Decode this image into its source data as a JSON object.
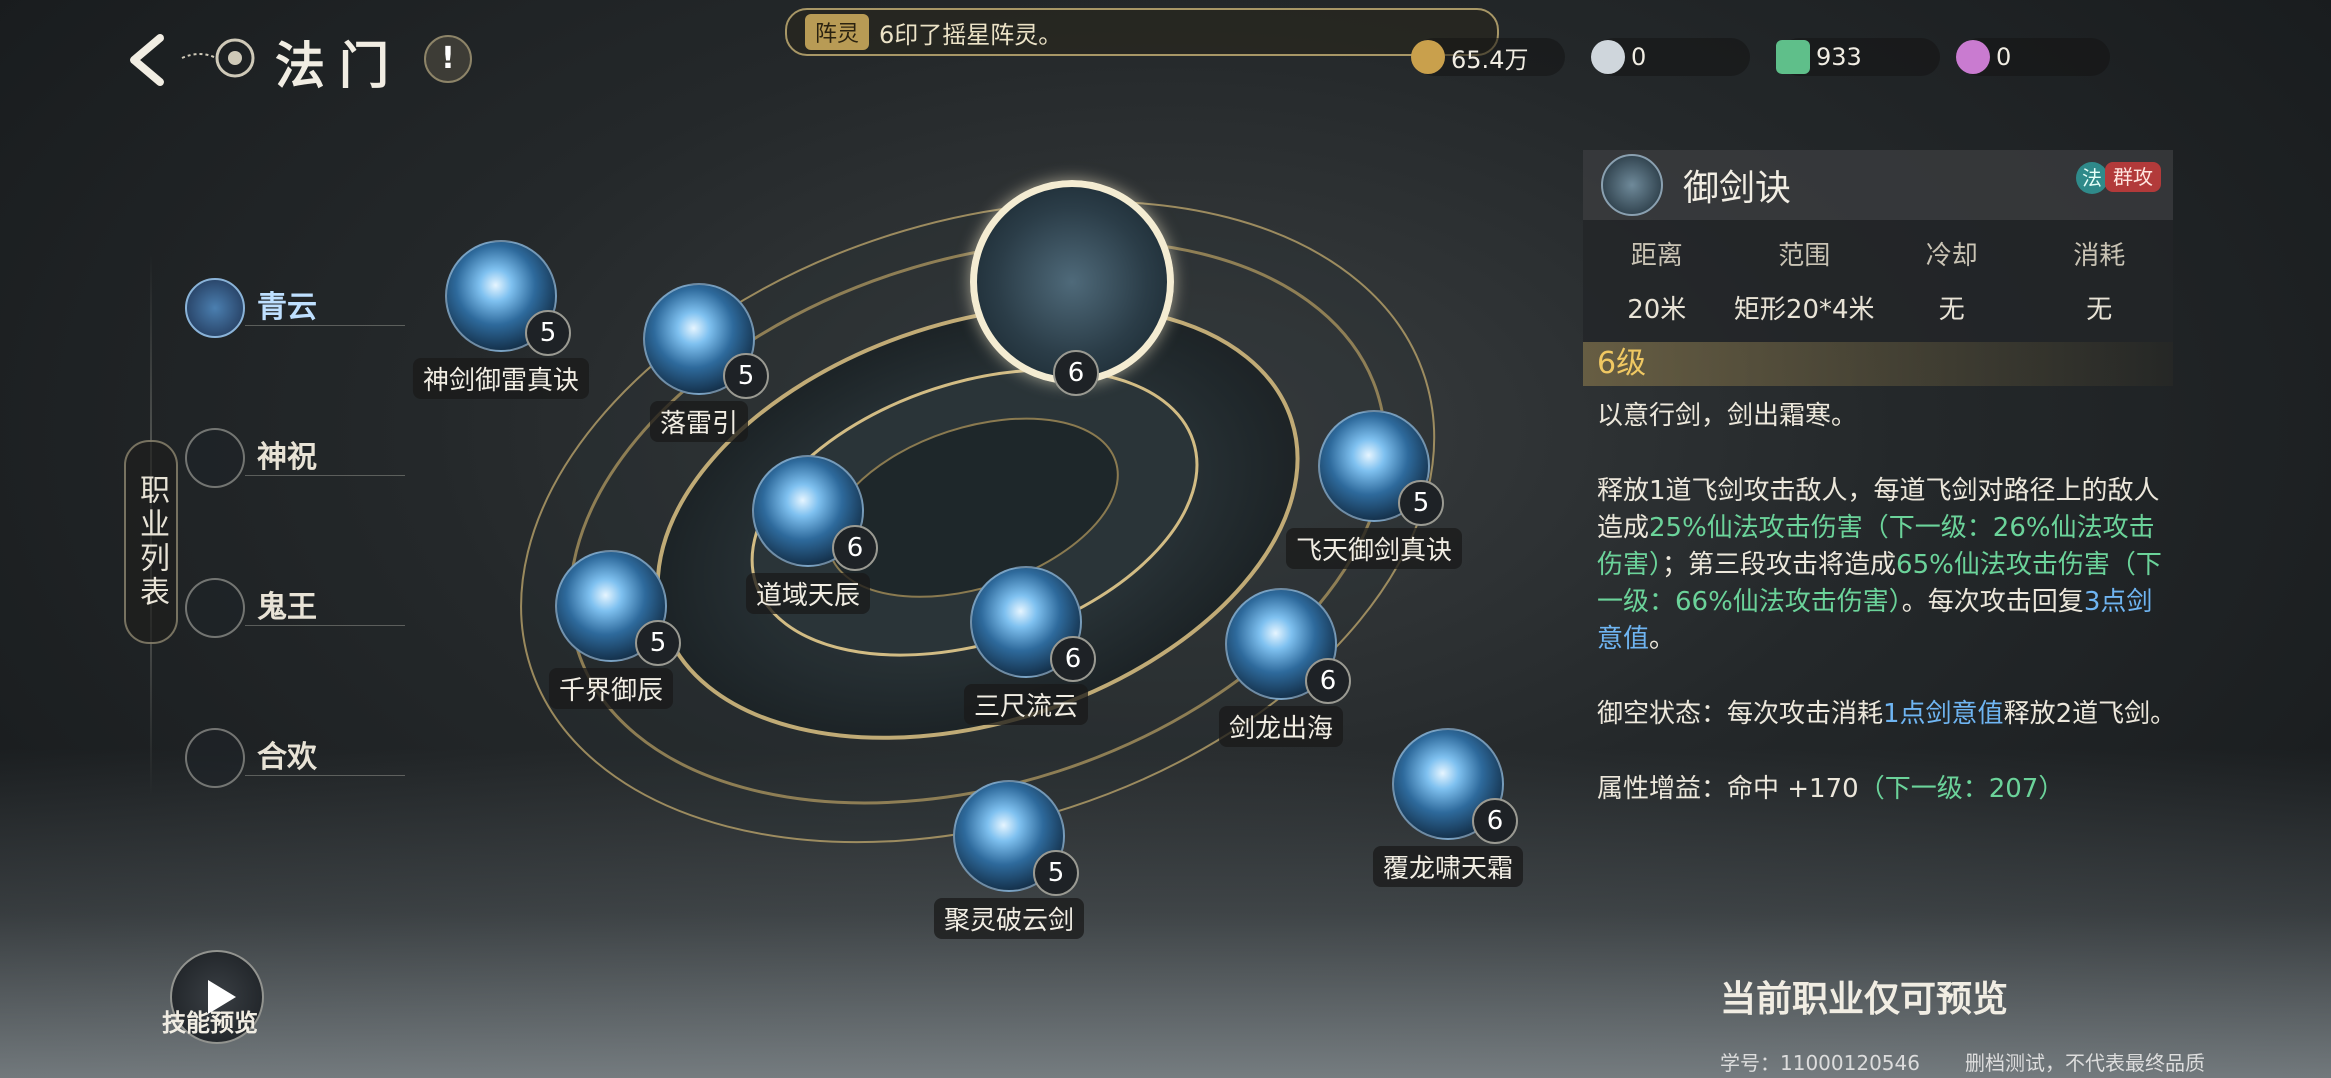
{
  "header": {
    "title": "法门",
    "info_icon": "!",
    "notice": {
      "tag": "阵灵",
      "text": "6印了摇星阵灵。"
    },
    "resources": [
      {
        "name": "coin-icon",
        "value": "65.4万",
        "color": "#c9a04c"
      },
      {
        "name": "ingot-icon",
        "value": "0",
        "color": "#cfd6dc"
      },
      {
        "name": "jade-icon",
        "value": "933",
        "color": "#5fbf8a"
      },
      {
        "name": "pearl-icon",
        "value": "0",
        "color": "#c97bd0"
      }
    ]
  },
  "sidebar": {
    "section_label": "职业列表",
    "items": [
      {
        "label": "青云",
        "active": true
      },
      {
        "label": "神祝",
        "active": false
      },
      {
        "label": "鬼王",
        "active": false
      },
      {
        "label": "合欢",
        "active": false
      }
    ]
  },
  "skills": [
    {
      "name": "神剑御雷真诀",
      "level": "5"
    },
    {
      "name": "落雷引",
      "level": "5"
    },
    {
      "name": "",
      "level": "6",
      "selected": true
    },
    {
      "name": "道域天辰",
      "level": "6"
    },
    {
      "name": "飞天御剑真诀",
      "level": "5"
    },
    {
      "name": "千界御辰",
      "level": "5"
    },
    {
      "name": "三尺流云",
      "level": "6"
    },
    {
      "name": "剑龙出海",
      "level": "6"
    },
    {
      "name": "覆龙啸天霜",
      "level": "6"
    },
    {
      "name": "聚灵破云剑",
      "level": "5"
    }
  ],
  "detail": {
    "name": "御剑诀",
    "tag_type": "法",
    "tag_attack": "群攻",
    "stats_headers": [
      "距离",
      "范围",
      "冷却",
      "消耗"
    ],
    "stats_values": [
      "20米",
      "矩形20*4米",
      "无",
      "无"
    ],
    "level": "6级",
    "flavor": "以意行剑，剑出霜寒。",
    "desc1_a": "释放1道飞剑攻击敌人，每道飞剑对路径上的敌人造成",
    "desc1_b": "25%仙法攻击伤害（下一级：26%仙法攻击伤害）",
    "desc1_c": "；第三段攻击将造成",
    "desc1_d": "65%仙法攻击伤害（下一级：66%仙法攻击伤害）",
    "desc1_e": "。每次攻击回复",
    "desc1_f": "3点剑意值",
    "desc1_g": "。",
    "desc2_a": "御空状态：每次攻击消耗",
    "desc2_b": "1点剑意值",
    "desc2_c": "释放2道飞剑。",
    "desc3_a": "属性增益：命中 +170",
    "desc3_b": "（下一级：207）"
  },
  "bottom": {
    "notice": "当前职业仅可预览",
    "preview_label": "技能预览",
    "student_id": "学号：11000120546",
    "test_note": "删档测试，不代表最终品质"
  },
  "colors": {
    "accent_gold": "#f0c862",
    "green": "#6bd39a",
    "blue": "#6fb5f2"
  }
}
